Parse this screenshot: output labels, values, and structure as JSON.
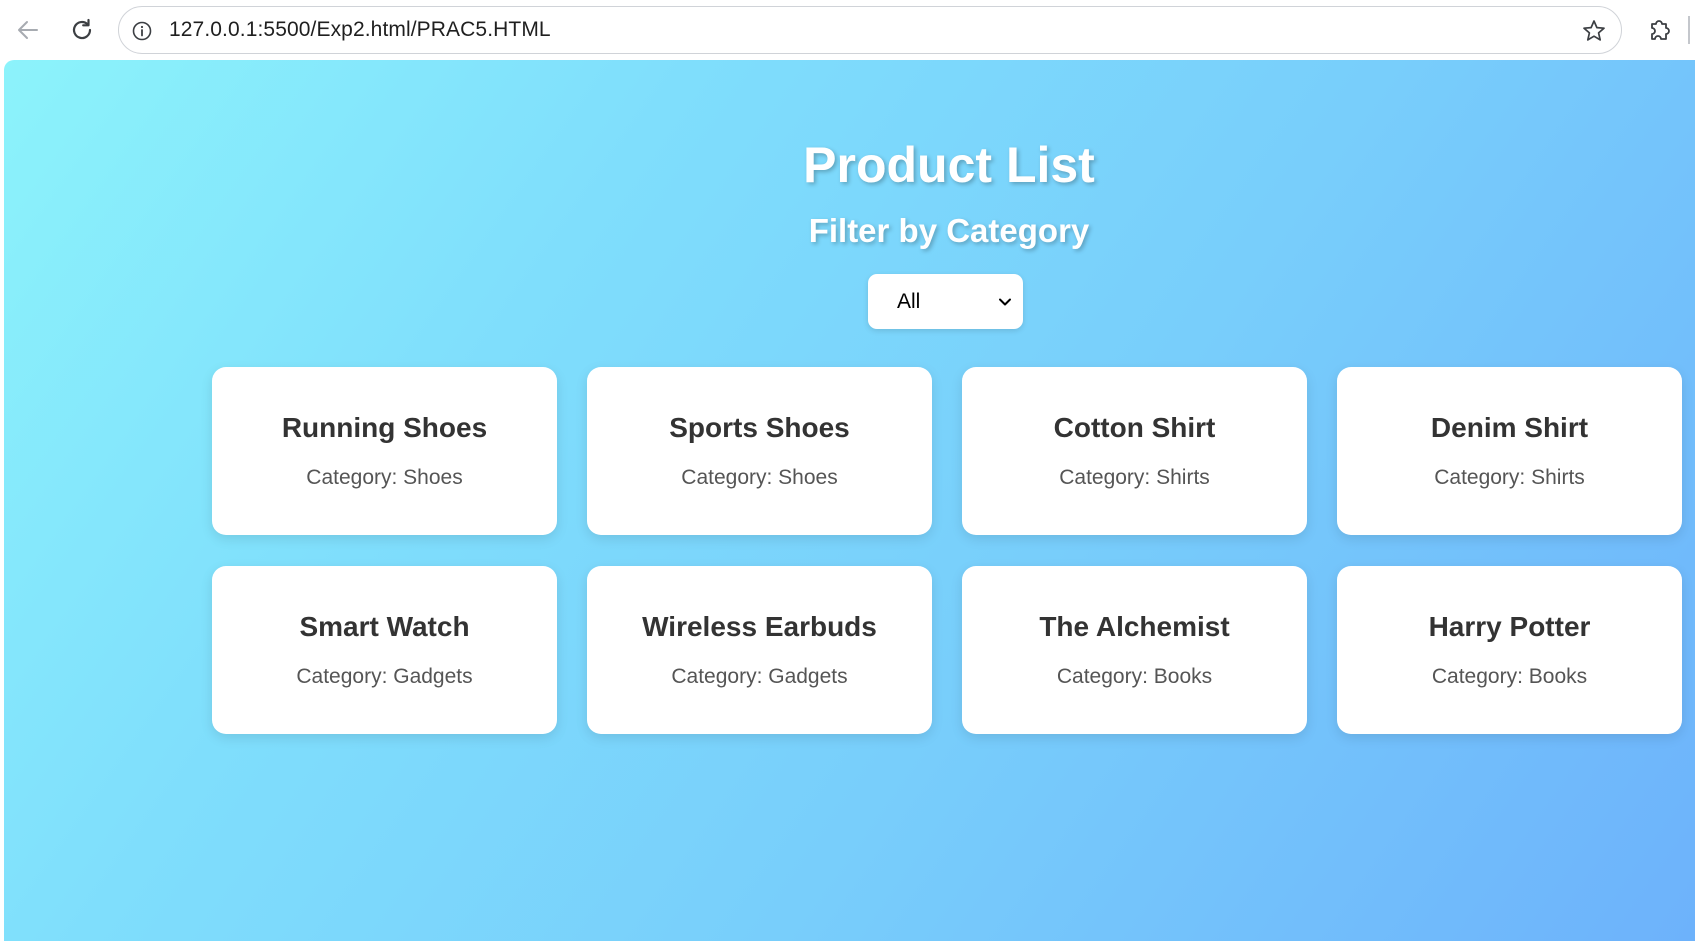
{
  "browser": {
    "url": "127.0.0.1:5500/Exp2.html/PRAC5.HTML",
    "icons": {
      "back": "back-arrow-icon",
      "reload": "reload-icon",
      "info": "info-icon",
      "bookmark": "star-icon",
      "extensions": "puzzle-icon"
    }
  },
  "page": {
    "title": "Product List",
    "subtitle": "Filter by Category",
    "filter": {
      "selected": "All"
    },
    "colors": {
      "gradient_start": "#8cf3fb",
      "gradient_end": "#6db2fb",
      "card_background": "#ffffff",
      "heading_text": "#ffffff",
      "product_name_text": "#333333",
      "product_category_text": "#555555"
    },
    "products": [
      {
        "name": "Running Shoes",
        "category_text": "Category: Shoes"
      },
      {
        "name": "Sports Shoes",
        "category_text": "Category: Shoes"
      },
      {
        "name": "Cotton Shirt",
        "category_text": "Category: Shirts"
      },
      {
        "name": "Denim Shirt",
        "category_text": "Category: Shirts"
      },
      {
        "name": "Smart Watch",
        "category_text": "Category: Gadgets"
      },
      {
        "name": "Wireless Earbuds",
        "category_text": "Category: Gadgets"
      },
      {
        "name": "The Alchemist",
        "category_text": "Category: Books"
      },
      {
        "name": "Harry Potter",
        "category_text": "Category: Books"
      }
    ]
  }
}
